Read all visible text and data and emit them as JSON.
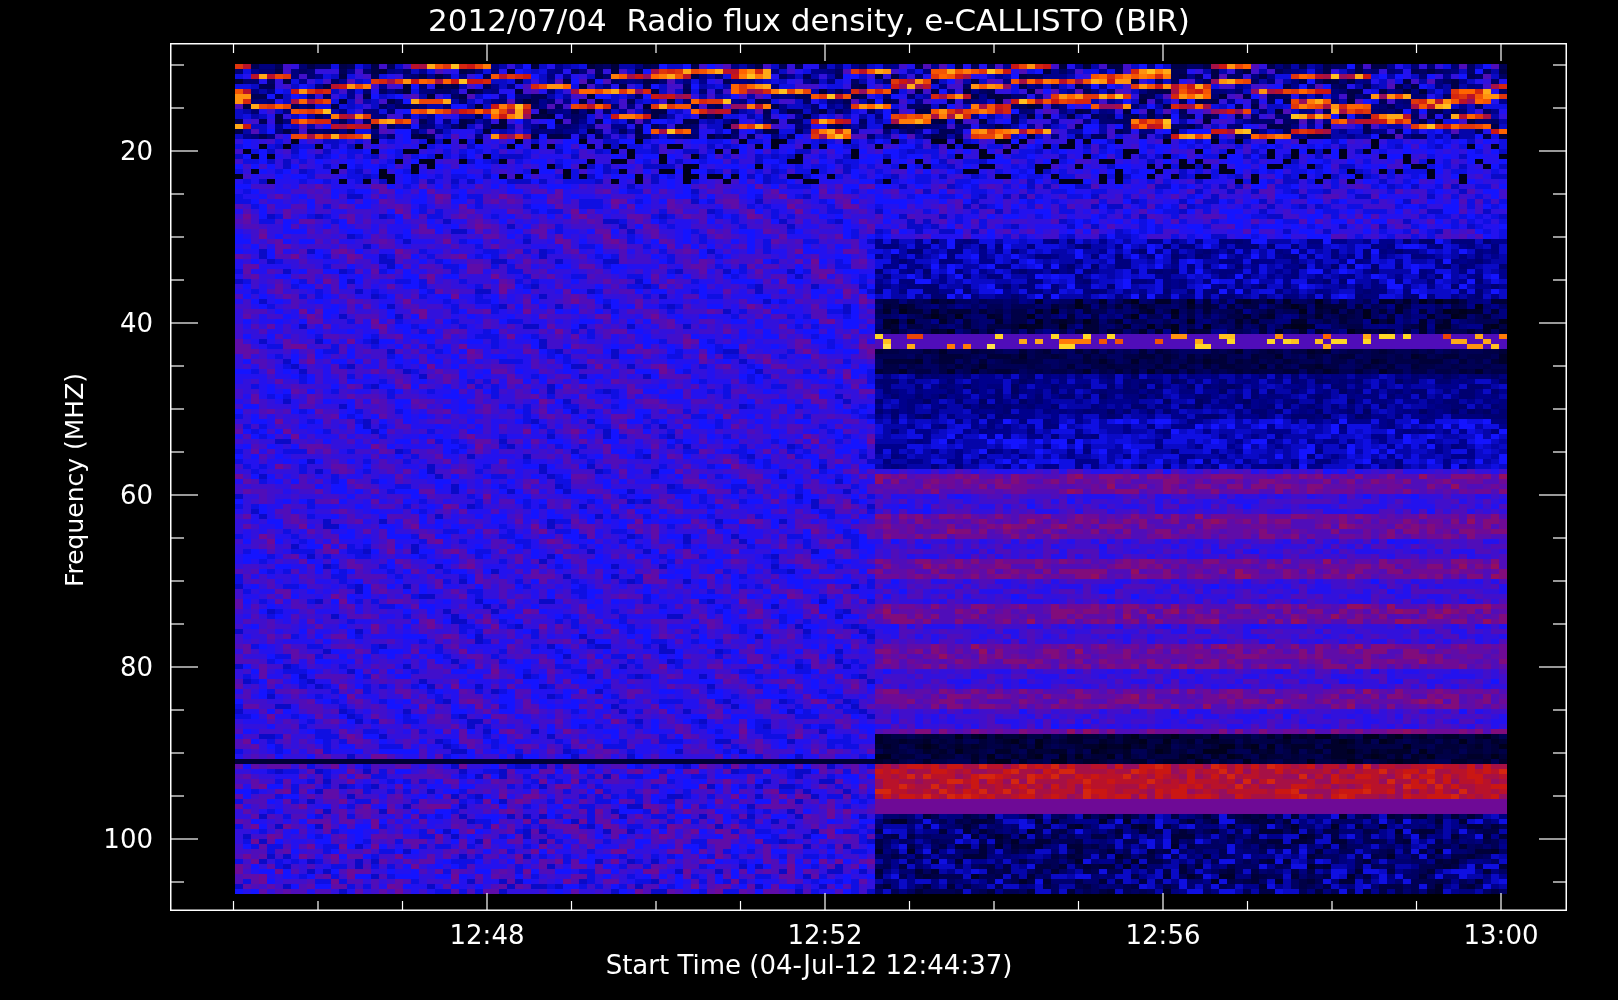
{
  "title": "2012/07/04  Radio flux density, e-CALLISTO (BIR)",
  "y_axis": {
    "label": "Frequency (MHZ)",
    "ticks": [
      "20",
      "40",
      "60",
      "80",
      "100"
    ]
  },
  "x_axis": {
    "label": "Start Time (04-Jul-12 12:44:37)",
    "ticks": [
      "12:48",
      "12:52",
      "12:56",
      "13:00"
    ]
  }
}
